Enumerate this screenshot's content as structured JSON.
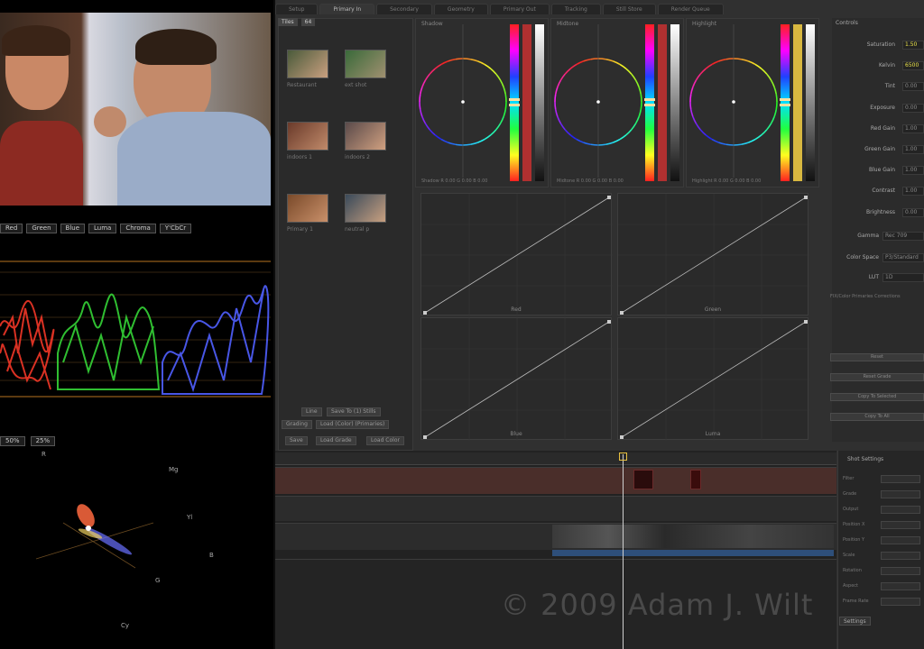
{
  "scope_buttons": [
    "Red",
    "Green",
    "Blue",
    "Luma",
    "Chroma",
    "Y'CbCr"
  ],
  "vector_buttons": [
    "50%",
    "25%"
  ],
  "vector_labels": {
    "r": "R",
    "mg": "Mg",
    "b": "B",
    "g": "G",
    "cy": "Cy",
    "yl": "Yl"
  },
  "tabs": [
    "Setup",
    "Primary In",
    "Secondary",
    "Geometry",
    "Primary Out",
    "Tracking",
    "Still Store",
    "Render Queue"
  ],
  "tabs_active": 1,
  "gallery": {
    "modes": [
      "Tiles",
      "64"
    ],
    "stills": [
      {
        "caption": "Restaurant"
      },
      {
        "caption": "ext shot"
      },
      {
        "caption": "indoors 1"
      },
      {
        "caption": "indoors 2"
      },
      {
        "caption": "Primary 1"
      },
      {
        "caption": "neutral p"
      }
    ],
    "footer_bar": [
      "Line",
      "Save To (1) Stills"
    ],
    "footer_buttons_row1": [
      "Grading",
      "Load (Color) (Primaries)"
    ],
    "footer_buttons_row2": [
      "Save",
      "Load Grade",
      "Load Color"
    ]
  },
  "wheels": [
    {
      "title": "Shadow",
      "readout": "Shadow  R  0.00  G  0.00  B  0.00"
    },
    {
      "title": "Midtone",
      "readout": "Midtone  R  0.00  G  0.00  B  0.00"
    },
    {
      "title": "Highlight",
      "readout": "Highlight  R 0.00 G 0.00 B 0.00"
    }
  ],
  "curves": [
    "Red",
    "Green",
    "Blue",
    "Luma"
  ],
  "params": {
    "header": "Controls",
    "rows": [
      {
        "label": "Saturation",
        "value": "1.50",
        "hl": true
      },
      {
        "label": "Kelvin",
        "value": "6500",
        "hl": true
      },
      {
        "label": "Tint",
        "value": "0.00",
        "hl": false
      },
      {
        "label": "Exposure",
        "value": "0.00",
        "hl": false
      },
      {
        "label": "Red Gain",
        "value": "1.00",
        "hl": false
      },
      {
        "label": "Green Gain",
        "value": "1.00",
        "hl": false
      },
      {
        "label": "Blue Gain",
        "value": "1.00",
        "hl": false
      },
      {
        "label": "Contrast",
        "value": "1.00",
        "hl": false
      },
      {
        "label": "Brightness",
        "value": "0.00",
        "hl": false
      }
    ],
    "gamma_label": "Gamma",
    "gamma_value": "Rec 709",
    "color_space_label": "Color Space",
    "color_space_value": "P3/Standard",
    "lut_label": "LUT",
    "lut_value": "1D",
    "note": "FIX/Color Primaries Corrections",
    "bottom_buttons": [
      "Reset",
      "Reset Grade",
      "Copy To Selected",
      "Copy To All"
    ]
  },
  "timeline": {
    "watermark": "© 2009 Adam J. Wilt",
    "right_header": "Shot Settings",
    "right_rows": [
      "Filter",
      "Grade",
      "Output",
      "Position X",
      "Position Y",
      "Scale",
      "Rotation",
      "Aspect",
      "Frame Rate"
    ],
    "settings_btn": "Settings"
  }
}
